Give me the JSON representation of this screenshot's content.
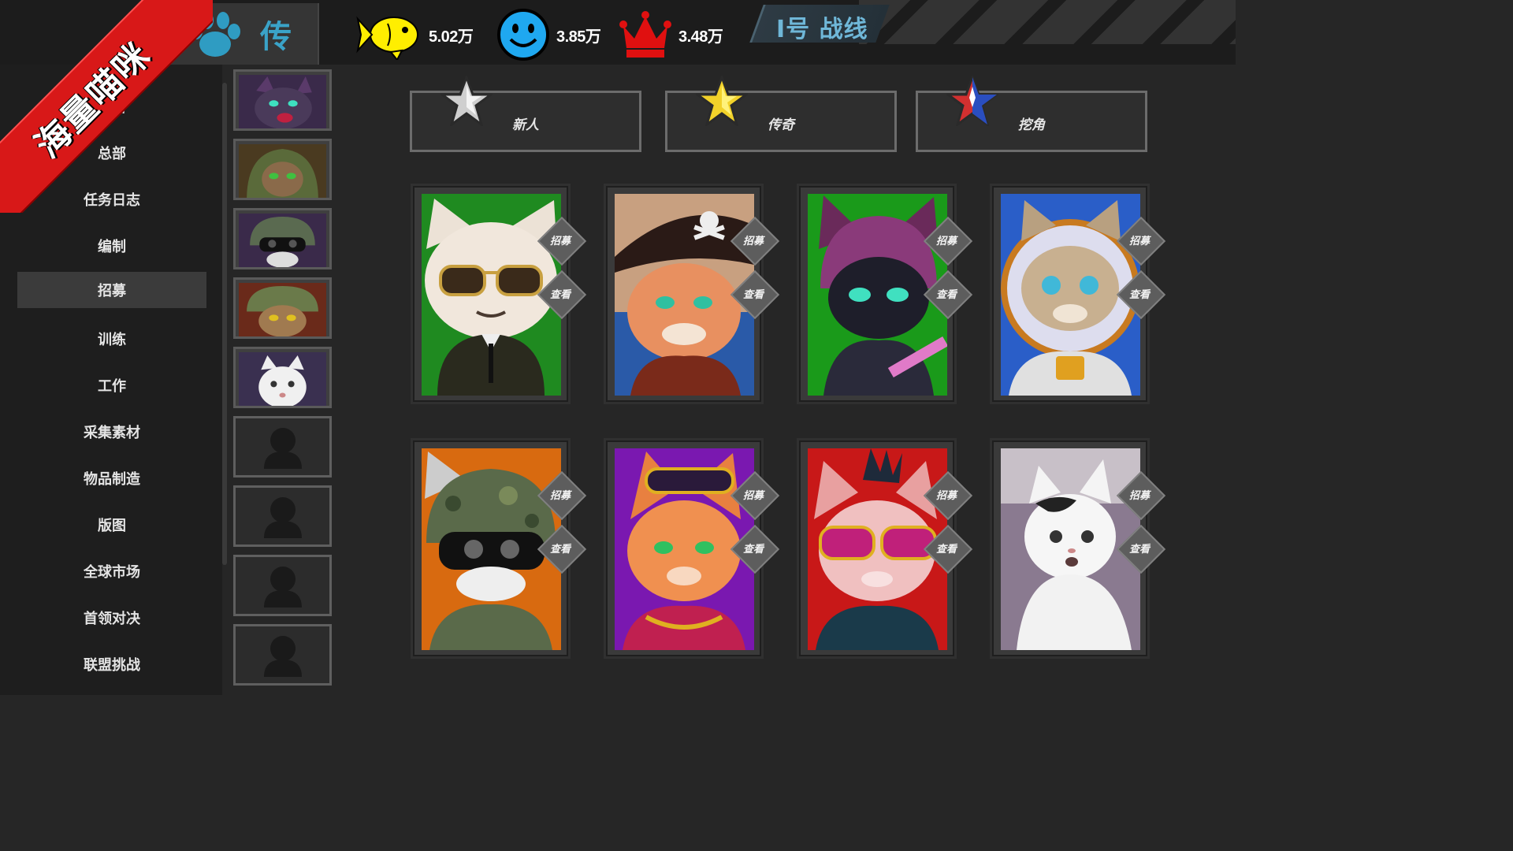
{
  "ribbon": {
    "text": "海量喵咪"
  },
  "header": {
    "rank": "传",
    "resources": [
      {
        "icon": "fish-icon",
        "value": "5.02万",
        "color": "#ffee00"
      },
      {
        "icon": "smiley-icon",
        "value": "3.85万",
        "color": "#1fa8f0"
      },
      {
        "icon": "crown-icon",
        "value": "3.48万",
        "color": "#e01010"
      }
    ],
    "frontline": "I号 战线"
  },
  "sidebar": {
    "items": [
      {
        "label": "出击"
      },
      {
        "label": "总部"
      },
      {
        "label": "任务日志"
      },
      {
        "label": "编制"
      },
      {
        "label": "招募",
        "active": true
      },
      {
        "label": "训练"
      },
      {
        "label": "工作"
      },
      {
        "label": "采集素材"
      },
      {
        "label": "物品制造"
      },
      {
        "label": "版图"
      },
      {
        "label": "全球市场"
      },
      {
        "label": "首领对决"
      },
      {
        "label": "联盟挑战"
      }
    ]
  },
  "roster": {
    "filled": 5,
    "empty": 4
  },
  "tabs": [
    {
      "label": "新人",
      "star_color": "#c8c8c8"
    },
    {
      "label": "传奇",
      "star_color": "#f2d22a"
    },
    {
      "label": "挖角",
      "star_color": "#d23030"
    }
  ],
  "cards": [
    {
      "name": "sunglasses-suit-cat",
      "bg": "#1f8a20",
      "recruit": "招募",
      "view": "查看"
    },
    {
      "name": "pirate-cat",
      "bg": "#6a3a2a",
      "recruit": "招募",
      "view": "查看"
    },
    {
      "name": "ninja-cat",
      "bg": "#1a9a1a",
      "recruit": "招募",
      "view": "查看"
    },
    {
      "name": "astronaut-cat",
      "bg": "#2a5ec8",
      "recruit": "招募",
      "view": "查看"
    },
    {
      "name": "soldier-cat",
      "bg": "#d86a10",
      "recruit": "招募",
      "view": "查看"
    },
    {
      "name": "rapper-cat",
      "bg": "#7a18b0",
      "recruit": "招募",
      "view": "查看"
    },
    {
      "name": "punk-cat",
      "bg": "#c81818",
      "recruit": "招募",
      "view": "查看"
    },
    {
      "name": "meme-cat",
      "bg": "#9a8ca0",
      "recruit": "招募",
      "view": "查看"
    }
  ]
}
